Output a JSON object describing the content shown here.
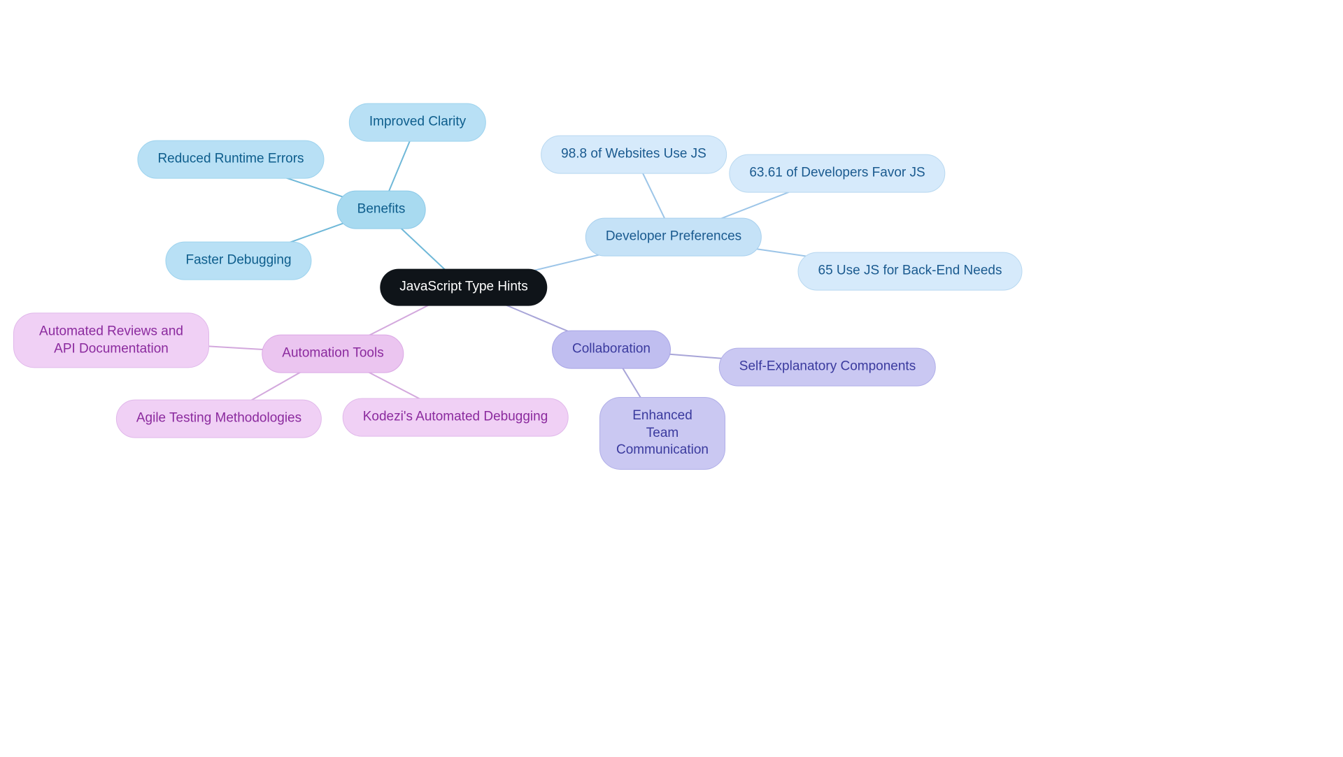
{
  "center": {
    "label": "JavaScript Type Hints"
  },
  "branches": {
    "benefits": {
      "label": "Benefits",
      "leaves": [
        {
          "id": "improved_clarity",
          "label": "Improved Clarity"
        },
        {
          "id": "reduced_runtime",
          "label": "Reduced Runtime Errors"
        },
        {
          "id": "faster_debugging",
          "label": "Faster Debugging"
        }
      ]
    },
    "developer_prefs": {
      "label": "Developer Preferences",
      "leaves": [
        {
          "id": "websites_js",
          "label": "98.8 of Websites Use JS"
        },
        {
          "id": "devs_favor",
          "label": "63.61 of Developers Favor JS"
        },
        {
          "id": "backend_js",
          "label": "65 Use JS for Back-End Needs"
        }
      ]
    },
    "automation": {
      "label": "Automation Tools",
      "leaves": [
        {
          "id": "automated_reviews",
          "label": "Automated Reviews and API Documentation"
        },
        {
          "id": "agile_testing",
          "label": "Agile Testing Methodologies"
        },
        {
          "id": "kodezi",
          "label": "Kodezi's Automated Debugging"
        }
      ]
    },
    "collaboration": {
      "label": "Collaboration",
      "leaves": [
        {
          "id": "self_explanatory",
          "label": "Self-Explanatory Components"
        },
        {
          "id": "team_comm",
          "label": "Enhanced Team Communication"
        }
      ]
    }
  },
  "edge_colors": {
    "benefits": "#6fb8d8",
    "developer_prefs": "#9cc5e8",
    "automation": "#d3a8dd",
    "collaboration": "#a8a5d8"
  }
}
